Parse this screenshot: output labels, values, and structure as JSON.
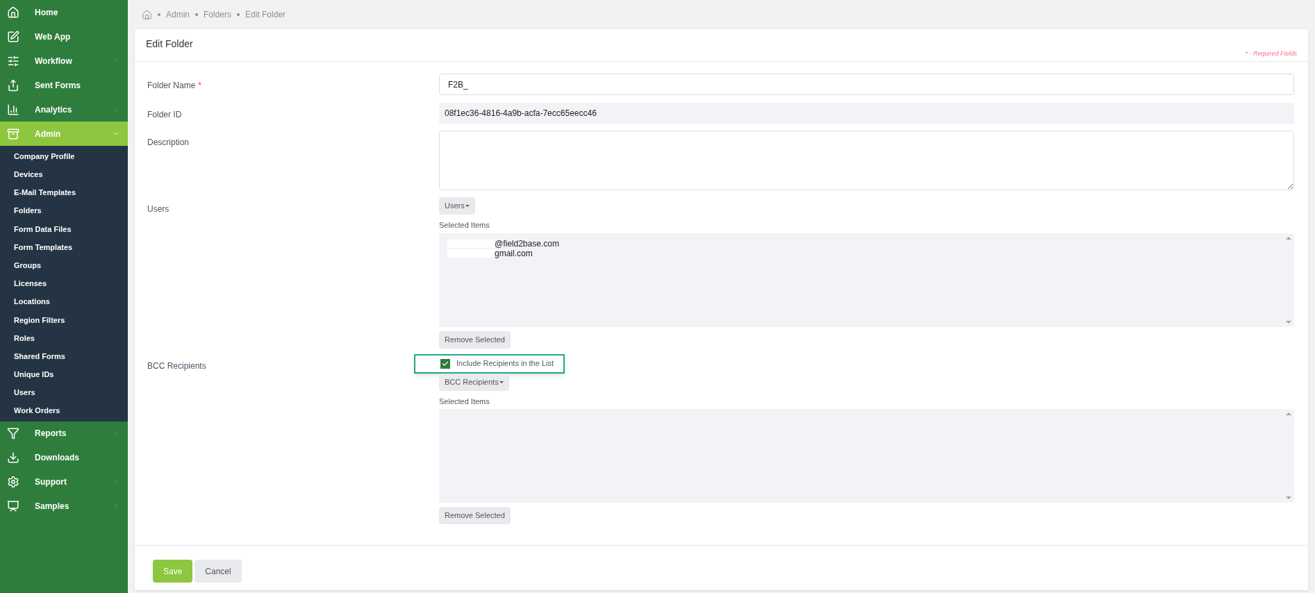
{
  "sidebar": {
    "items": [
      {
        "label": "Home",
        "selected": false
      },
      {
        "label": "Web App",
        "selected": false
      },
      {
        "label": "Workflow",
        "selected": false,
        "expanded": false
      },
      {
        "label": "Sent Forms",
        "selected": false
      },
      {
        "label": "Analytics",
        "selected": false,
        "expanded": false
      },
      {
        "label": "Admin",
        "selected": true,
        "expanded": true,
        "children": [
          {
            "label": "Company Profile"
          },
          {
            "label": "Devices"
          },
          {
            "label": "E-Mail Templates"
          },
          {
            "label": "Folders"
          },
          {
            "label": "Form Data Files"
          },
          {
            "label": "Form Templates"
          },
          {
            "label": "Groups"
          },
          {
            "label": "Licenses"
          },
          {
            "label": "Locations"
          },
          {
            "label": "Region Filters"
          },
          {
            "label": "Roles"
          },
          {
            "label": "Shared Forms"
          },
          {
            "label": "Unique IDs"
          },
          {
            "label": "Users"
          },
          {
            "label": "Work Orders"
          }
        ]
      },
      {
        "label": "Reports",
        "selected": false,
        "expanded": false
      },
      {
        "label": "Downloads",
        "selected": false
      },
      {
        "label": "Support",
        "selected": false,
        "expanded": false
      },
      {
        "label": "Samples",
        "selected": false,
        "expanded": false
      }
    ]
  },
  "breadcrumb": [
    "Admin",
    "Folders",
    "Edit Folder"
  ],
  "card": {
    "title": "Edit Folder",
    "required_note": "* - Required Fields",
    "folder_name": {
      "label": "Folder Name",
      "required_mark": "*",
      "value": "F2B_"
    },
    "folder_id": {
      "label": "Folder ID",
      "value": "08f1ec36-4816-4a9b-acfa-7ecc65eecc46"
    },
    "description": {
      "label": "Description"
    },
    "users": {
      "label": "Users",
      "button": "Users",
      "selected_label": "Selected Items",
      "items": [
        "@field2base.com",
        "gmail.com"
      ],
      "remove": "Remove Selected"
    },
    "bcc": {
      "label": "BCC Recipients",
      "checkbox": {
        "label": "Include Recipients in the List",
        "checked": true,
        "highlighted": true
      },
      "button": "BCC Recipients",
      "selected_label": "Selected Items",
      "remove": "Remove Selected"
    },
    "buttons": [
      {
        "label": "Save",
        "kind": "primary"
      },
      {
        "label": "Cancel",
        "kind": "secondary"
      }
    ]
  }
}
